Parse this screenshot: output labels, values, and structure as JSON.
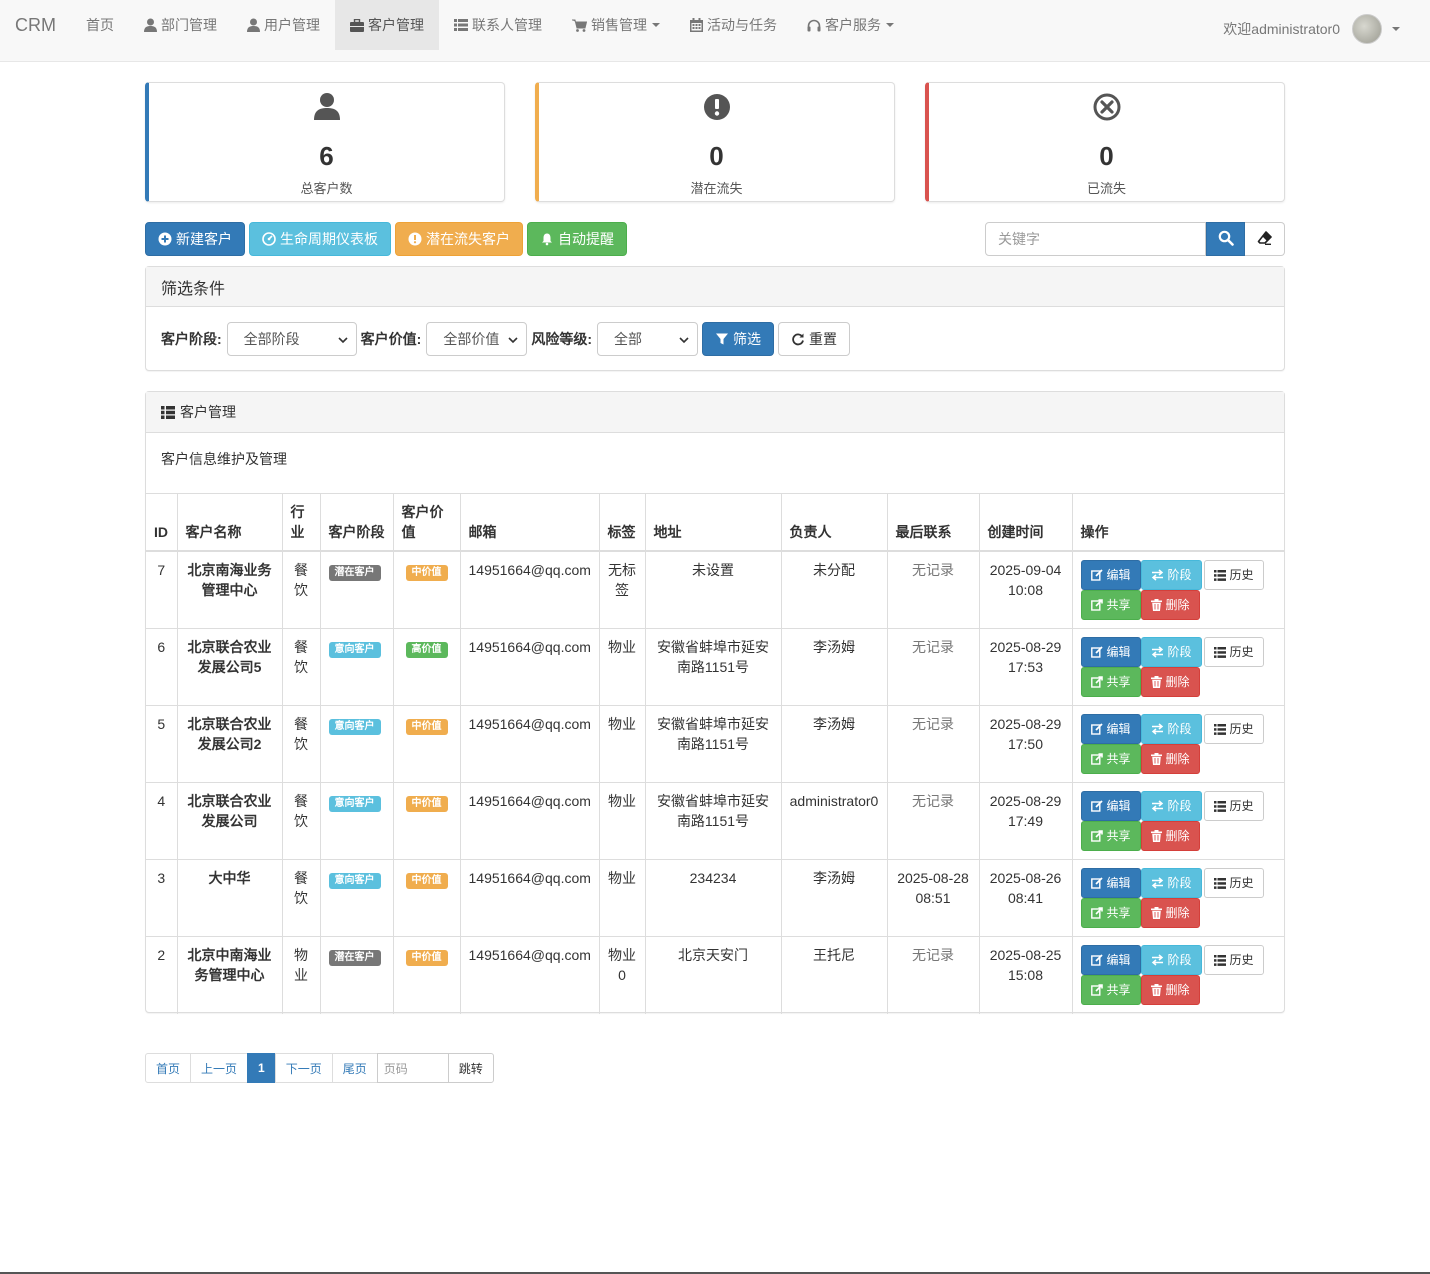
{
  "nav": {
    "brand": "CRM",
    "items": [
      {
        "label": "首页",
        "icon": "",
        "dropdown": false,
        "active": false
      },
      {
        "label": "部门管理",
        "icon": "user-icon",
        "dropdown": false,
        "active": false
      },
      {
        "label": "用户管理",
        "icon": "user-icon",
        "dropdown": false,
        "active": false
      },
      {
        "label": "客户管理",
        "icon": "briefcase-icon",
        "dropdown": false,
        "active": true
      },
      {
        "label": "联系人管理",
        "icon": "list-icon",
        "dropdown": false,
        "active": false
      },
      {
        "label": "销售管理",
        "icon": "cart-icon",
        "dropdown": true,
        "active": false
      },
      {
        "label": "活动与任务",
        "icon": "calendar-icon",
        "dropdown": false,
        "active": false
      },
      {
        "label": "客户服务",
        "icon": "headphones-icon",
        "dropdown": true,
        "active": false
      }
    ],
    "welcome": "欢迎administrator0"
  },
  "stats": [
    {
      "value": "6",
      "label": "总客户数",
      "icon": "user-icon",
      "color": "#337ab7"
    },
    {
      "value": "0",
      "label": "潜在流失",
      "icon": "exclamation-circle-icon",
      "color": "#f0ad4e"
    },
    {
      "value": "0",
      "label": "已流失",
      "icon": "remove-circle-icon",
      "color": "#d9534f"
    }
  ],
  "toolbar": {
    "new_customer": "新建客户",
    "lifecycle": "生命周期仪表板",
    "churn": "潜在流失客户",
    "reminder": "自动提醒"
  },
  "search": {
    "placeholder": "关键字"
  },
  "filter": {
    "title": "筛选条件",
    "stage_label": "客户阶段:",
    "stage_value": "全部阶段",
    "value_label": "客户价值:",
    "value_value": "全部价值",
    "risk_label": "风险等级:",
    "risk_value": "全部",
    "filter_btn": "筛选",
    "reset_btn": "重置"
  },
  "panel": {
    "title": "客户管理",
    "description": "客户信息维护及管理"
  },
  "table": {
    "headers": [
      "ID",
      "客户名称",
      "行业",
      "客户阶段",
      "客户价值",
      "邮箱",
      "标签",
      "地址",
      "负责人",
      "最后联系",
      "创建时间",
      "操作"
    ],
    "rows": [
      {
        "id": "7",
        "name": "北京南海业务管理中心",
        "industry": "餐饮",
        "stage": "潜在客户",
        "stage_color": "#777777",
        "value": "中价值",
        "value_color": "#f0ad4e",
        "email": "14951664@qq.com",
        "tag": "无标签",
        "address": "未设置",
        "owner": "未分配",
        "last_contact": "无记录",
        "created": "2025-09-04 10:08"
      },
      {
        "id": "6",
        "name": "北京联合农业发展公司5",
        "industry": "餐饮",
        "stage": "意向客户",
        "stage_color": "#5bc0de",
        "value": "高价值",
        "value_color": "#5cb85c",
        "email": "14951664@qq.com",
        "tag": "物业",
        "address": "安徽省蚌埠市延安南路1151号",
        "owner": "李汤姆",
        "last_contact": "无记录",
        "created": "2025-08-29 17:53"
      },
      {
        "id": "5",
        "name": "北京联合农业发展公司2",
        "industry": "餐饮",
        "stage": "意向客户",
        "stage_color": "#5bc0de",
        "value": "中价值",
        "value_color": "#f0ad4e",
        "email": "14951664@qq.com",
        "tag": "物业",
        "address": "安徽省蚌埠市延安南路1151号",
        "owner": "李汤姆",
        "last_contact": "无记录",
        "created": "2025-08-29 17:50"
      },
      {
        "id": "4",
        "name": "北京联合农业发展公司",
        "industry": "餐饮",
        "stage": "意向客户",
        "stage_color": "#5bc0de",
        "value": "中价值",
        "value_color": "#f0ad4e",
        "email": "14951664@qq.com",
        "tag": "物业",
        "address": "安徽省蚌埠市延安南路1151号",
        "owner": "administrator0",
        "last_contact": "无记录",
        "created": "2025-08-29 17:49"
      },
      {
        "id": "3",
        "name": "大中华",
        "industry": "餐饮",
        "stage": "意向客户",
        "stage_color": "#5bc0de",
        "value": "中价值",
        "value_color": "#f0ad4e",
        "email": "14951664@qq.com",
        "tag": "物业",
        "address": "234234",
        "owner": "李汤姆",
        "last_contact": "2025-08-28 08:51",
        "created": "2025-08-26 08:41"
      },
      {
        "id": "2",
        "name": "北京中南海业务管理中心",
        "industry": "物业",
        "stage": "潜在客户",
        "stage_color": "#777777",
        "value": "中价值",
        "value_color": "#f0ad4e",
        "email": "14951664@qq.com",
        "tag": "物业0",
        "address": "北京天安门",
        "owner": "王托尼",
        "last_contact": "无记录",
        "created": "2025-08-25 15:08"
      }
    ],
    "actions": {
      "edit": "编辑",
      "stage": "阶段",
      "history": "历史",
      "share": "共享",
      "delete": "删除"
    }
  },
  "pagination": {
    "first": "首页",
    "prev": "上一页",
    "current": "1",
    "next": "下一页",
    "last": "尾页",
    "page_placeholder": "页码",
    "jump": "跳转"
  }
}
